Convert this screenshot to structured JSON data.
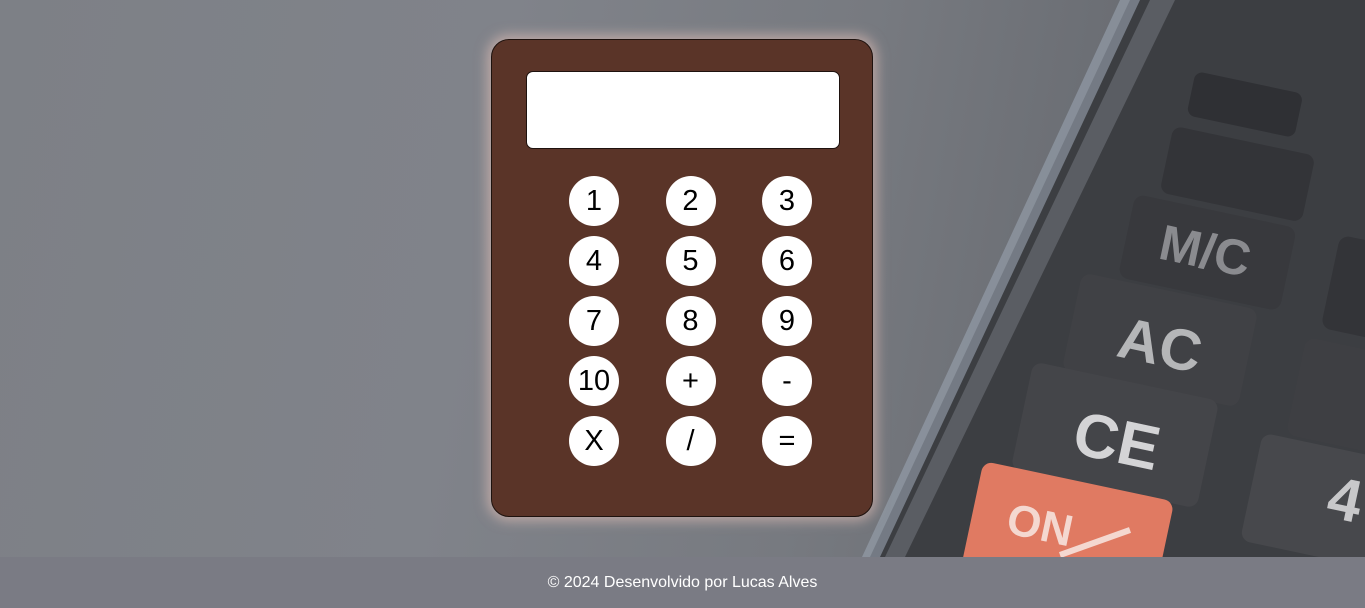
{
  "calculator": {
    "display_value": "",
    "keys": [
      "1",
      "2",
      "3",
      "4",
      "5",
      "6",
      "7",
      "8",
      "9",
      "10",
      "+",
      "-",
      "X",
      "/",
      "="
    ]
  },
  "footer": {
    "text": "© 2024 Desenvolvido por Lucas Alves"
  },
  "background": {
    "keys": [
      "M/C",
      "AC",
      "CE",
      "ON",
      "4"
    ]
  },
  "colors": {
    "calculator_body": "#5a3428",
    "display": "#ffffff",
    "key": "#ffffff",
    "footer": "#7a7b84",
    "on_key": "#e07a62"
  }
}
